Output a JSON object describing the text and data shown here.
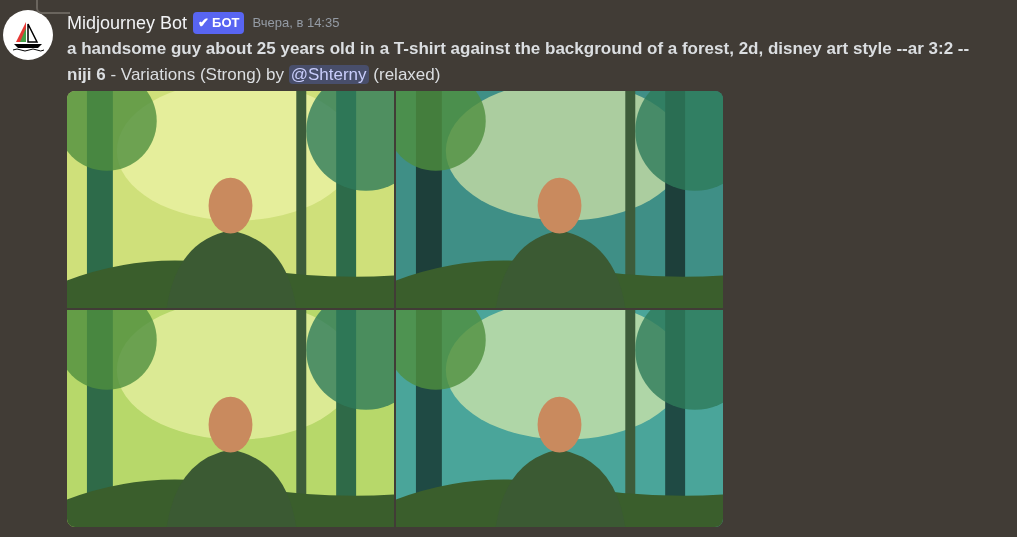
{
  "message": {
    "author": "Midjourney Bot",
    "badge": {
      "check": "✔",
      "label": "БОТ"
    },
    "timestamp": "Вчера, в 14:35",
    "text_before": "**a handsome guy about 25 years old in a T-shirt against the background of a forest, 2d, disney art style --ar 3:2 --niji 6** - Variations (Strong) by",
    "mention": "@Shterny",
    "text_after": "(relaxed)"
  }
}
